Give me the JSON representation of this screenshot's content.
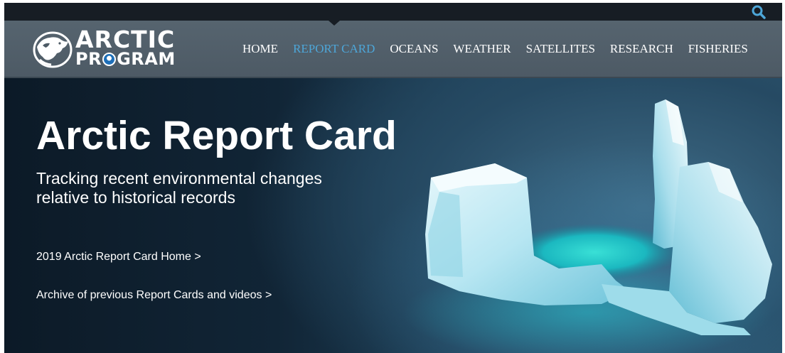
{
  "header": {
    "search_icon": "search-icon",
    "logo": {
      "line1": "ARCTIC",
      "line2_pre": "PR",
      "line2_post": "GRAM"
    },
    "nav": [
      {
        "label": "HOME",
        "active": false
      },
      {
        "label": "REPORT CARD",
        "active": true
      },
      {
        "label": "OCEANS",
        "active": false
      },
      {
        "label": "WEATHER",
        "active": false
      },
      {
        "label": "SATELLITES",
        "active": false
      },
      {
        "label": "RESEARCH",
        "active": false
      },
      {
        "label": "FISHERIES",
        "active": false
      }
    ]
  },
  "hero": {
    "title": "Arctic Report Card",
    "subtitle": "Tracking recent environmental changes relative to historical records",
    "links": [
      "2019 Arctic Report Card Home >",
      "Archive of previous Report Cards and videos >"
    ]
  },
  "colors": {
    "topbar": "#171d24",
    "navbar": "#56646f",
    "nav_active": "#4da6d8",
    "search_icon": "#4da6d8"
  }
}
